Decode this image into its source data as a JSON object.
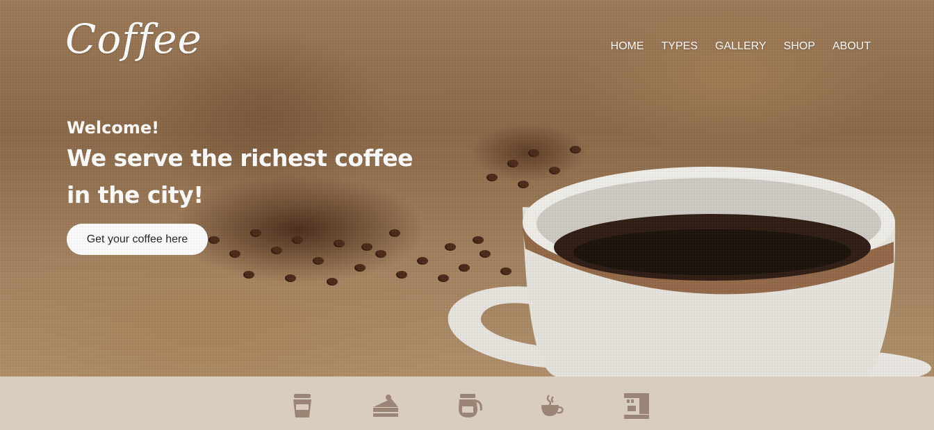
{
  "header": {
    "logo": "Coffee",
    "nav": [
      "HOME",
      "TYPES",
      "GALLERY",
      "SHOP",
      "ABOUT"
    ]
  },
  "hero": {
    "welcome": "Welcome!",
    "headline": "We serve the richest coffee in the city!",
    "cta_label": "Get your coffee here"
  },
  "icon_bar": {
    "icons": [
      "takeaway-cup-icon",
      "cake-slice-icon",
      "coffee-pot-icon",
      "hot-cup-icon",
      "espresso-machine-icon"
    ]
  },
  "colors": {
    "icon_bar_bg": "#d9cebd",
    "icon_color": "#9b8577",
    "button_bg": "#ffffff",
    "text_light": "#ffffff"
  }
}
